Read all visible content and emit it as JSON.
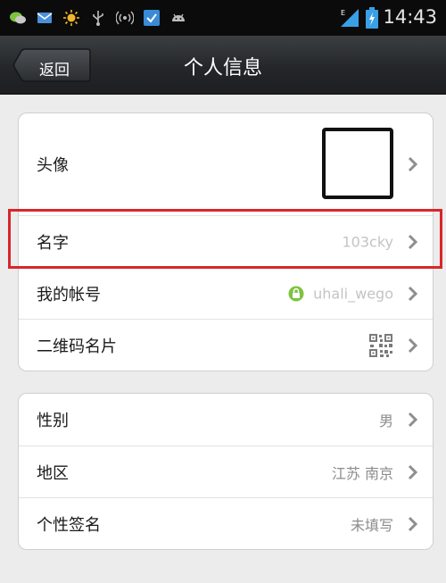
{
  "status_bar": {
    "time": "14:43",
    "icons": [
      "chat-icon",
      "mail-icon",
      "sun-icon",
      "usb-icon",
      "wifi-signal-icon",
      "download-icon",
      "android-icon",
      "signal-icon",
      "battery-icon"
    ]
  },
  "navbar": {
    "back_label": "返回",
    "title": "个人信息"
  },
  "profile_card": {
    "avatar_label": "头像",
    "name_label": "名字",
    "name_value": "103cky",
    "account_label": "我的帐号",
    "account_value": "uhali_wego",
    "qrcode_label": "二维码名片"
  },
  "details_card": {
    "gender_label": "性别",
    "gender_value": "男",
    "region_label": "地区",
    "region_value": "江苏 南京",
    "signature_label": "个性签名",
    "signature_value": "未填写"
  },
  "colors": {
    "highlight": "#d8262c",
    "lock_green": "#7fc241"
  }
}
